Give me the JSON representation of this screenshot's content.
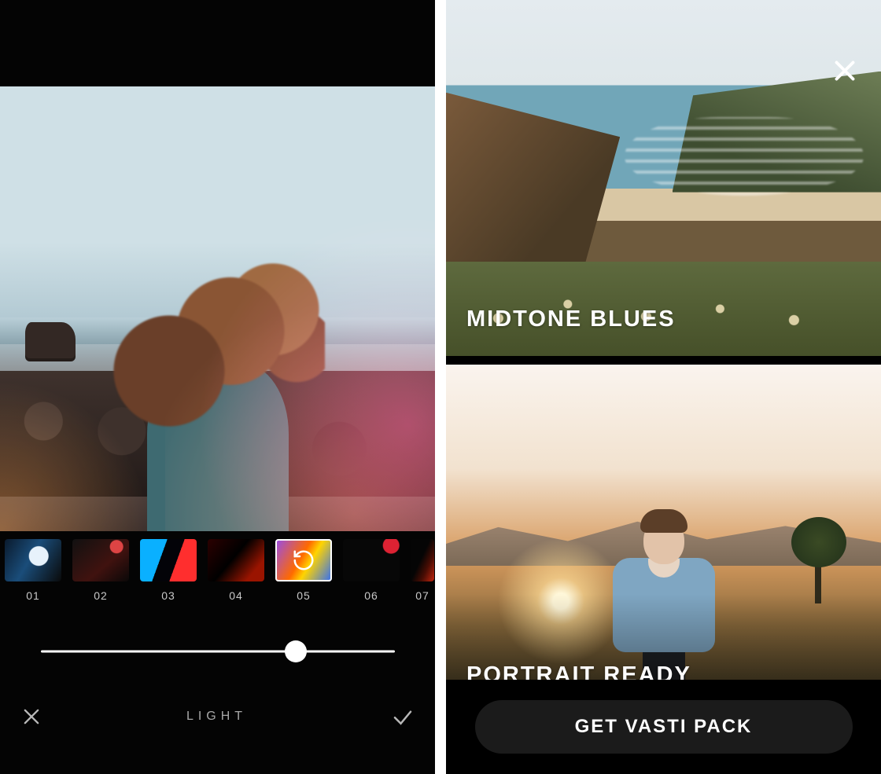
{
  "editor": {
    "adjust_label": "LIGHT",
    "slider_value": 0.72,
    "selected_filter_index": 4,
    "filters": [
      {
        "label": "01"
      },
      {
        "label": "02"
      },
      {
        "label": "03"
      },
      {
        "label": "04"
      },
      {
        "label": "05"
      },
      {
        "label": "06"
      },
      {
        "label": "07"
      }
    ]
  },
  "presets": {
    "items": [
      {
        "title": "MIDTONE BLUES"
      },
      {
        "title": "PORTRAIT READY"
      }
    ],
    "cta_label": "GET VASTI PACK"
  }
}
